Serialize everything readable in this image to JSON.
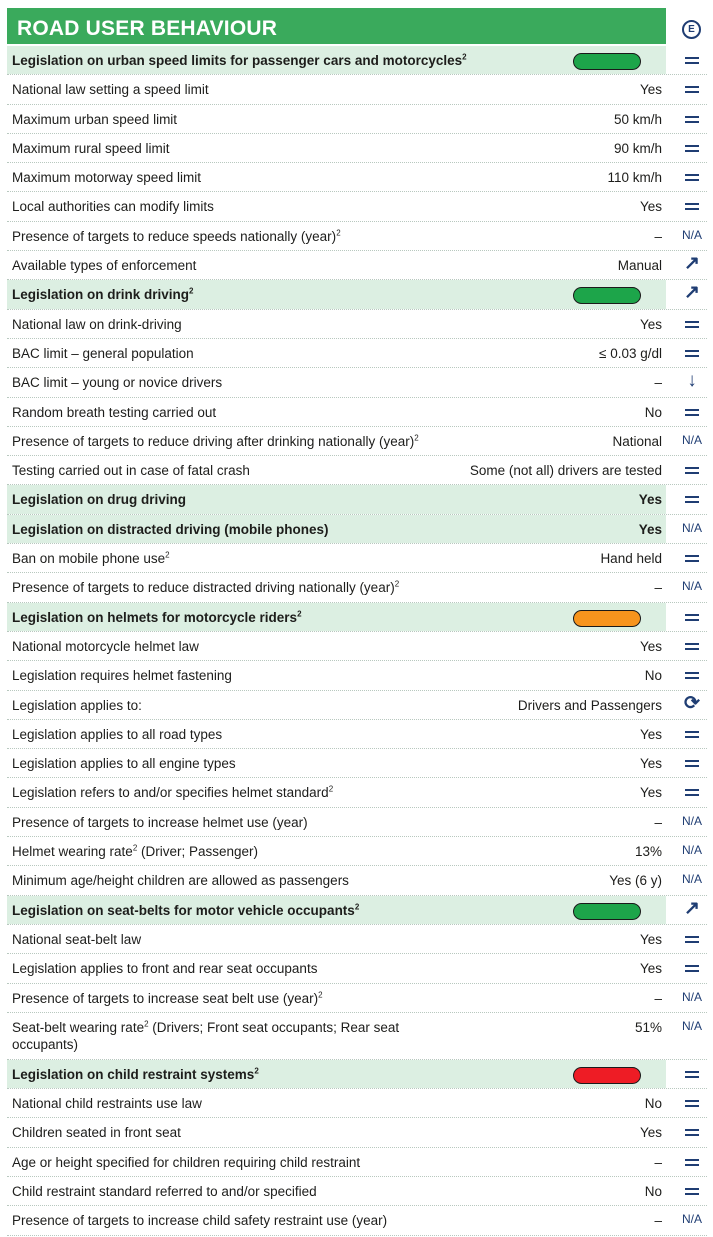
{
  "title": "ROAD USER BEHAVIOUR",
  "badge": "E",
  "colors": {
    "green": "#1da54a",
    "orange": "#f7941d",
    "red": "#ee1c25",
    "header_shade": "#dcefe2",
    "title_bg": "#3aaa5c"
  },
  "rows": [
    {
      "label": "Legislation on urban speed limits for passenger cars and motorcycles",
      "sup": "2",
      "value": "",
      "trend": "equal",
      "head": true,
      "pill": "green"
    },
    {
      "label": "National law setting a speed limit",
      "sup": "",
      "value": "Yes",
      "trend": "equal"
    },
    {
      "label": "Maximum urban speed limit",
      "sup": "",
      "value": "50 km/h",
      "trend": "equal"
    },
    {
      "label": "Maximum rural speed limit",
      "sup": "",
      "value": "90 km/h",
      "trend": "equal"
    },
    {
      "label": "Maximum motorway speed limit",
      "sup": "",
      "value": "110 km/h",
      "trend": "equal"
    },
    {
      "label": "Local authorities can modify limits",
      "sup": "",
      "value": "Yes",
      "trend": "equal"
    },
    {
      "label": "Presence of targets to reduce speeds nationally (year)",
      "sup": "2",
      "value": "–",
      "trend": "na"
    },
    {
      "label": "Available types of enforcement",
      "sup": "",
      "value": "Manual",
      "trend": "up"
    },
    {
      "label": "Legislation on drink driving",
      "sup": "2",
      "value": "",
      "trend": "up",
      "head": true,
      "pill": "green"
    },
    {
      "label": "National law on drink-driving",
      "sup": "",
      "value": "Yes",
      "trend": "equal"
    },
    {
      "label": "BAC limit – general population",
      "sup": "",
      "value": "≤ 0.03 g/dl",
      "trend": "equal"
    },
    {
      "label": "BAC limit – young or novice drivers",
      "sup": "",
      "value": "–",
      "trend": "down"
    },
    {
      "label": "Random breath testing carried out",
      "sup": "",
      "value": "No",
      "trend": "equal"
    },
    {
      "label": "Presence of targets to reduce driving after drinking nationally (year)",
      "sup": "2",
      "value": "National",
      "trend": "na"
    },
    {
      "label": "Testing carried out in case of fatal crash",
      "sup": "",
      "value": "Some (not all) drivers are tested",
      "trend": "equal"
    },
    {
      "label": "Legislation on drug driving",
      "sup": "",
      "value": "Yes",
      "trend": "equal",
      "head": true
    },
    {
      "label": "Legislation on distracted driving (mobile phones)",
      "sup": "",
      "value": "Yes",
      "trend": "na",
      "head": true
    },
    {
      "label": "Ban on mobile phone use",
      "sup": "2",
      "value": "Hand held",
      "trend": "equal"
    },
    {
      "label": "Presence of targets to reduce distracted driving nationally (year)",
      "sup": "2",
      "value": "–",
      "trend": "na"
    },
    {
      "label": "Legislation on helmets for motorcycle riders",
      "sup": "2",
      "value": "",
      "trend": "equal",
      "head": true,
      "pill": "orange"
    },
    {
      "label": "National motorcycle helmet law",
      "sup": "",
      "value": "Yes",
      "trend": "equal"
    },
    {
      "label": "Legislation requires helmet fastening",
      "sup": "",
      "value": "No",
      "trend": "equal"
    },
    {
      "label": "Legislation applies to:",
      "sup": "",
      "value": "Drivers and Passengers",
      "trend": "changed"
    },
    {
      "label": "Legislation applies to all road types",
      "sup": "",
      "value": "Yes",
      "trend": "equal"
    },
    {
      "label": "Legislation applies to all engine types",
      "sup": "",
      "value": "Yes",
      "trend": "equal"
    },
    {
      "label": "Legislation refers to and/or specifies helmet standard",
      "sup": "2",
      "value": "Yes",
      "trend": "equal"
    },
    {
      "label": "Presence of targets to increase helmet use (year)",
      "sup": "",
      "value": "–",
      "trend": "na"
    },
    {
      "label": "Helmet wearing rate",
      "sup": "2",
      "suffix": " (Driver; Passenger)",
      "value": "13%",
      "trend": "na"
    },
    {
      "label": "Minimum age/height children are allowed as passengers",
      "sup": "",
      "value": "Yes (6 y)",
      "trend": "na"
    },
    {
      "label": "Legislation on seat-belts for motor vehicle occupants",
      "sup": "2",
      "value": "",
      "trend": "up",
      "head": true,
      "pill": "green"
    },
    {
      "label": "National seat-belt law",
      "sup": "",
      "value": "Yes",
      "trend": "equal"
    },
    {
      "label": "Legislation applies to front and rear seat occupants",
      "sup": "",
      "value": "Yes",
      "trend": "equal"
    },
    {
      "label": "Presence of targets to increase seat belt use (year)",
      "sup": "2",
      "value": "–",
      "trend": "na"
    },
    {
      "label": "Seat-belt wearing rate",
      "sup": "2",
      "suffix": " (Drivers; Front seat occupants; Rear seat occupants)",
      "value": "51%",
      "trend": "na",
      "tall": true
    },
    {
      "label": "Legislation on child restraint systems",
      "sup": "2",
      "value": "",
      "trend": "equal",
      "head": true,
      "pill": "red"
    },
    {
      "label": "National child restraints use law",
      "sup": "",
      "value": "No",
      "trend": "equal"
    },
    {
      "label": "Children seated in front seat",
      "sup": "",
      "value": "Yes",
      "trend": "equal"
    },
    {
      "label": "Age or height specified for children requiring child restraint",
      "sup": "",
      "value": "–",
      "trend": "equal"
    },
    {
      "label": "Child restraint standard referred to and/or specified",
      "sup": "",
      "value": "No",
      "trend": "equal"
    },
    {
      "label": "Presence of targets to increase child safety restraint use (year)",
      "sup": "",
      "value": "–",
      "trend": "na"
    }
  ],
  "trend_text": {
    "na": "N/A",
    "up": "↗",
    "down": "↓",
    "changed": "⟳"
  }
}
